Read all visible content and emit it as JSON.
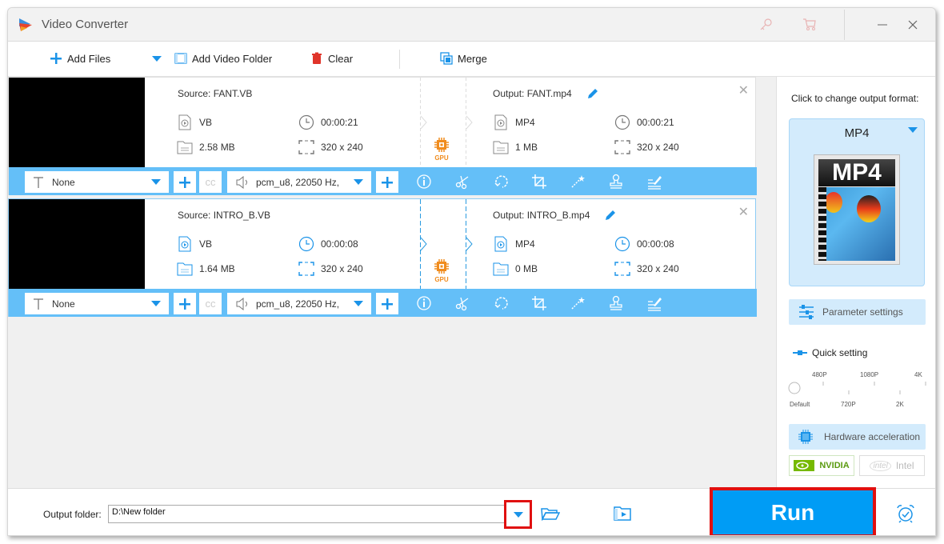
{
  "window": {
    "title": "Video Converter",
    "icons": [
      "key-icon",
      "cart-icon",
      "minimize-icon",
      "close-icon"
    ]
  },
  "toolbar": {
    "add_files": "Add Files",
    "add_video_folder": "Add Video Folder",
    "clear": "Clear",
    "merge": "Merge"
  },
  "items": [
    {
      "source_title": "Source: FANT.VB",
      "source": {
        "format": "VB",
        "duration": "00:00:21",
        "size": "2.58 MB",
        "resolution": "320 x 240"
      },
      "output_title": "Output: FANT.mp4",
      "output": {
        "format": "MP4",
        "duration": "00:00:21",
        "size": "1 MB",
        "resolution": "320 x 240"
      },
      "gpu_label": "GPU",
      "subtitle": "None",
      "audio": "pcm_u8, 22050 Hz,",
      "selected": false
    },
    {
      "source_title": "Source: INTRO_B.VB",
      "source": {
        "format": "VB",
        "duration": "00:00:08",
        "size": "1.64 MB",
        "resolution": "320 x 240"
      },
      "output_title": "Output: INTRO_B.mp4",
      "output": {
        "format": "MP4",
        "duration": "00:00:08",
        "size": "0 MB",
        "resolution": "320 x 240"
      },
      "gpu_label": "GPU",
      "subtitle": "None",
      "audio": "pcm_u8, 22050 Hz,",
      "selected": true
    }
  ],
  "edit_tools": [
    "info-icon",
    "scissors-icon",
    "rotate-icon",
    "crop-icon",
    "effects-wand-icon",
    "watermark-stamp-icon",
    "subtitle-edit-icon"
  ],
  "right_panel": {
    "format_label": "Click to change output format:",
    "format": "MP4",
    "format_image_text": "MP4",
    "parameter_settings": "Parameter settings",
    "quick_setting": "Quick setting",
    "slider_top_labels": [
      "480P",
      "1080P",
      "4K"
    ],
    "slider_bottom_labels": [
      "Default",
      "720P",
      "2K"
    ],
    "slider_value": "Default",
    "hardware_acceleration": "Hardware acceleration",
    "nvidia": "NVIDIA",
    "intel": "Intel",
    "intel_logo": "intel"
  },
  "bottom": {
    "output_folder_label": "Output folder:",
    "output_folder_value": "D:\\New folder",
    "run": "Run"
  },
  "colors": {
    "accent": "#1a93e8",
    "edit_bar": "#64bff8",
    "run": "#009cf5",
    "highlight": "#e01010",
    "gpu": "#f08c1e",
    "clear_icon": "#e0342a"
  }
}
